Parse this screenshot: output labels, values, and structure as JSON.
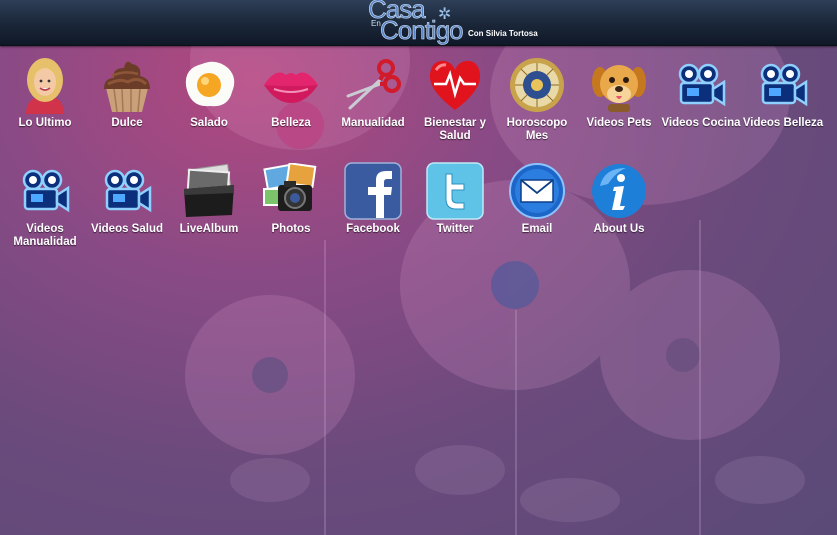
{
  "header": {
    "logo_line1": "Casa",
    "logo_line2": "Contigo",
    "logo_small": "En",
    "subtitle": "Con Silvia Tortosa"
  },
  "apps": [
    {
      "label": "Lo Ultimo",
      "icon": "woman-portrait-icon"
    },
    {
      "label": "Dulce",
      "icon": "cupcake-icon"
    },
    {
      "label": "Salado",
      "icon": "fried-egg-icon"
    },
    {
      "label": "Belleza",
      "icon": "lips-icon"
    },
    {
      "label": "Manualidad",
      "icon": "scissors-icon"
    },
    {
      "label": "Bienestar y Salud",
      "icon": "heart-pulse-icon"
    },
    {
      "label": "Horoscopo Mes",
      "icon": "zodiac-wheel-icon"
    },
    {
      "label": "Videos Pets",
      "icon": "puppy-icon"
    },
    {
      "label": "Videos Cocina",
      "icon": "video-camera-icon"
    },
    {
      "label": "Videos Belleza",
      "icon": "video-camera-icon"
    },
    {
      "label": "Videos Manualidad",
      "icon": "video-camera-icon"
    },
    {
      "label": "Videos Salud",
      "icon": "video-camera-icon"
    },
    {
      "label": "LiveAlbum",
      "icon": "photo-stack-icon"
    },
    {
      "label": "Photos",
      "icon": "camera-photos-icon"
    },
    {
      "label": "Facebook",
      "icon": "facebook-icon"
    },
    {
      "label": "Twitter",
      "icon": "twitter-icon"
    },
    {
      "label": "Email",
      "icon": "envelope-icon"
    },
    {
      "label": "About Us",
      "icon": "info-icon"
    }
  ],
  "colors": {
    "header_top": "#2e3f57",
    "header_bottom": "#0f1827",
    "background": "#7a4a80",
    "label": "#ffffff"
  }
}
